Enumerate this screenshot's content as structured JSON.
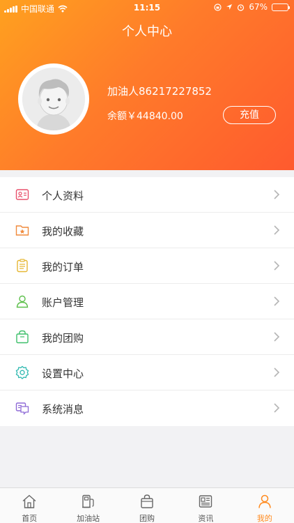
{
  "status_bar": {
    "carrier": "中国联通",
    "time": "11:15",
    "battery": "67%",
    "battery_level": 0.67
  },
  "page_title": "个人中心",
  "profile": {
    "name": "加油人86217227852",
    "balance": "余额￥44840.00",
    "recharge_label": "充值"
  },
  "menu": [
    {
      "label": "个人资料",
      "icon": "profile-card-icon",
      "color": "#e8506b"
    },
    {
      "label": "我的收藏",
      "icon": "favorites-folder-icon",
      "color": "#f08a3c"
    },
    {
      "label": "我的订单",
      "icon": "order-list-icon",
      "color": "#e6b733"
    },
    {
      "label": "账户管理",
      "icon": "account-person-icon",
      "color": "#5cbf4a"
    },
    {
      "label": "我的团购",
      "icon": "group-buy-bag-icon",
      "color": "#3cbf6a"
    },
    {
      "label": "设置中心",
      "icon": "settings-gear-icon",
      "color": "#2fb9b0"
    },
    {
      "label": "系统消息",
      "icon": "message-icon",
      "color": "#8e6ad6"
    }
  ],
  "tabbar": [
    {
      "label": "首页",
      "icon": "home-icon",
      "active": false
    },
    {
      "label": "加油站",
      "icon": "gas-pump-icon",
      "active": false
    },
    {
      "label": "团购",
      "icon": "shopping-bag-icon",
      "active": false
    },
    {
      "label": "资讯",
      "icon": "news-icon",
      "active": false
    },
    {
      "label": "我的",
      "icon": "person-icon",
      "active": true
    }
  ],
  "colors": {
    "accent": "#ff8a1e",
    "header_start": "#ffa11f",
    "header_end": "#ff5a2e"
  }
}
